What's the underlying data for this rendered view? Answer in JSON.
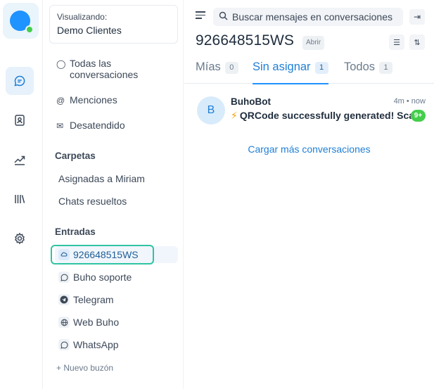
{
  "rail": {
    "items": [
      {
        "icon": "chat-icon",
        "active": true
      },
      {
        "icon": "contacts-icon",
        "active": false
      },
      {
        "icon": "reports-icon",
        "active": false
      },
      {
        "icon": "library-icon",
        "active": false
      },
      {
        "icon": "settings-icon",
        "active": false
      }
    ]
  },
  "account": {
    "label": "Visualizando:",
    "name": "Demo Clientes"
  },
  "nav": {
    "all": "Todas las conversaciones",
    "all_line1": "Todas las",
    "all_line2": "conversaciones",
    "mentions": "Menciones",
    "unattended": "Desatendido"
  },
  "folders": {
    "title": "Carpetas",
    "items": [
      "Asignadas a Miriam",
      "Chats resueltos"
    ]
  },
  "inboxes": {
    "title": "Entradas",
    "items": [
      {
        "label": "926648515WS",
        "icon": "api-icon",
        "active": true
      },
      {
        "label": "Buho soporte",
        "icon": "whatsapp-icon",
        "active": false
      },
      {
        "label": "Telegram",
        "icon": "telegram-icon",
        "active": false
      },
      {
        "label": "Web Buho",
        "icon": "globe-icon",
        "active": false
      },
      {
        "label": "WhatsApp",
        "icon": "whatsapp-icon",
        "active": false
      }
    ],
    "new_label": "Nuevo buzón"
  },
  "search": {
    "placeholder": "Buscar mensajes en conversaciones"
  },
  "header": {
    "title": "926648515WS",
    "status": "Abrir"
  },
  "tabs": [
    {
      "label": "Mías",
      "count": "0",
      "active": false
    },
    {
      "label": "Sin asignar",
      "count": "1",
      "active": true
    },
    {
      "label": "Todos",
      "count": "1",
      "active": false
    }
  ],
  "conversations": [
    {
      "avatar": "B",
      "sender": "BuhoBot",
      "time": "4m • now",
      "preview": "QRCode successfully generated! Scan",
      "unread": "9+"
    }
  ],
  "load_more": "Cargar más conversaciones",
  "colors": {
    "accent": "#1f93ff",
    "online": "#44ce4b",
    "highlight_outline": "#2fc4a3"
  }
}
